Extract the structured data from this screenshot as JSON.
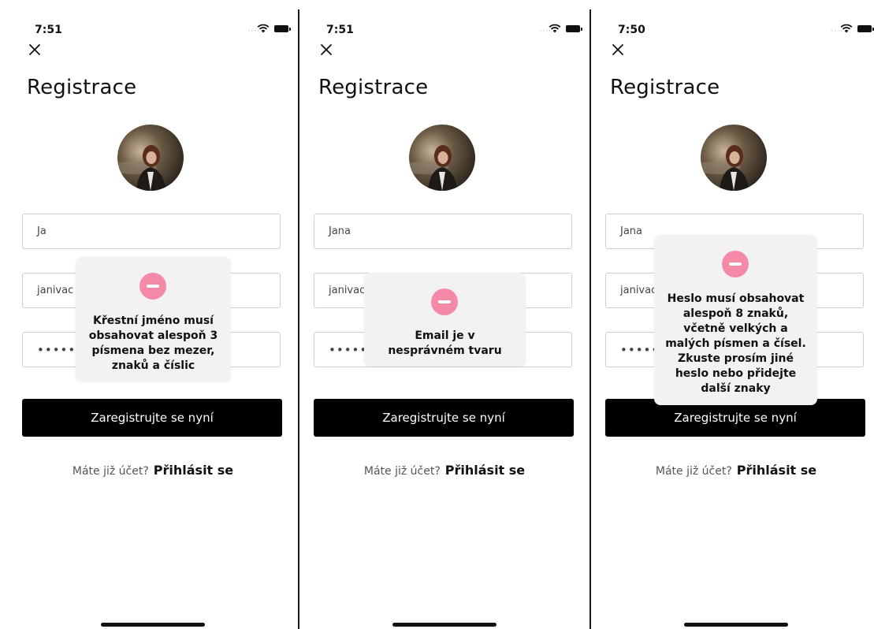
{
  "screens": [
    {
      "time": "7:51",
      "title": "Registrace",
      "first_name": "Ja",
      "email": "janivac",
      "password": "•••••",
      "register_button": "Zaregistrujte se nyní",
      "login_prompt": "Máte již účet?",
      "login_link": "Přihlásit se",
      "toast": "Křestní jméno musí obsahovat alespoň 3 písmena bez mezer, znaků a číslic"
    },
    {
      "time": "7:51",
      "title": "Registrace",
      "first_name": "Jana",
      "email": "janivac",
      "password": "•••••",
      "register_button": "Zaregistrujte se nyní",
      "login_prompt": "Máte již účet?",
      "login_link": "Přihlásit se",
      "toast": "Email je v nesprávném tvaru"
    },
    {
      "time": "7:50",
      "title": "Registrace",
      "first_name": "Jana",
      "email": "janivac",
      "password": "•••••",
      "register_button": "Zaregistrujte se nyní",
      "login_prompt": "Máte již účet?",
      "login_link": "Přihlásit se",
      "toast": "Heslo musí obsahovat alespoň 8 znaků, včetně velkých a malých písmen a čísel. Zkuste prosím jiné heslo nebo přidejte další znaky"
    }
  ],
  "icons": {
    "close": "close-icon",
    "wifi": "wifi-icon",
    "battery": "battery-icon",
    "signal": "signal-dots-icon",
    "error": "minus-circle-icon"
  },
  "colors": {
    "primary_button": "#000000",
    "toast_background": "#f2f2f4",
    "error_icon": "#f48aa7"
  }
}
